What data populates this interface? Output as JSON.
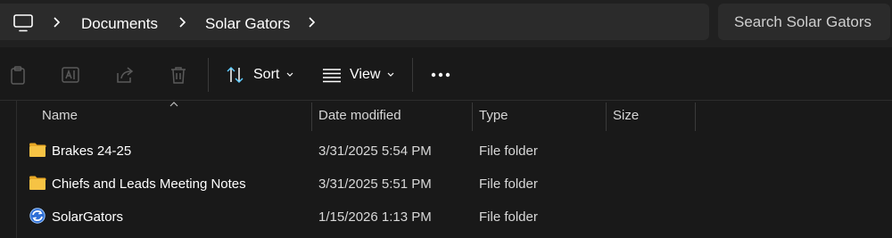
{
  "breadcrumb": {
    "items": [
      "Documents",
      "Solar Gators"
    ]
  },
  "search": {
    "placeholder": "Search Solar Gators"
  },
  "toolbar": {
    "sort_label": "Sort",
    "view_label": "View"
  },
  "columns": {
    "name": "Name",
    "date_modified": "Date modified",
    "type": "Type",
    "size": "Size"
  },
  "rows": [
    {
      "name": "Brakes 24-25",
      "date": "3/31/2025 5:54 PM",
      "type": "File folder",
      "size": "",
      "icon": "folder-icon"
    },
    {
      "name": "Chiefs and Leads Meeting Notes",
      "date": "3/31/2025 5:51 PM",
      "type": "File folder",
      "size": "",
      "icon": "folder-icon"
    },
    {
      "name": "SolarGators",
      "date": "1/15/2026 1:13 PM",
      "type": "File folder",
      "size": "",
      "icon": "sync-folder-icon"
    }
  ],
  "colors": {
    "background": "#191919",
    "address_bar": "#2b2b2b",
    "folder": "#f6c344",
    "accent": "#60cdff"
  }
}
